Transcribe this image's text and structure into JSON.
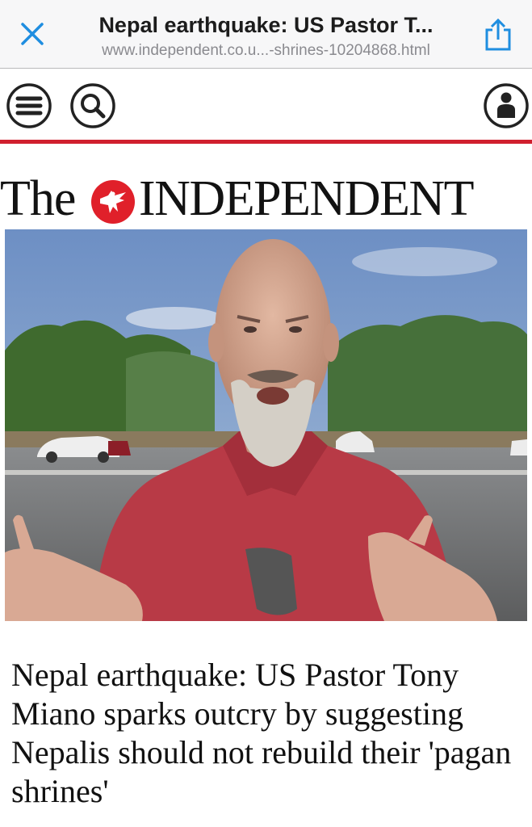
{
  "browser": {
    "page_title": "Nepal earthquake: US Pastor T...",
    "url": "www.independent.co.u...-shrines-10204868.html",
    "close_icon": "close-icon",
    "share_icon": "share-icon"
  },
  "nav": {
    "menu_icon": "menu-icon",
    "search_icon": "search-icon",
    "account_icon": "account-icon"
  },
  "masthead": {
    "the": "The",
    "name": "INDEPENDENT",
    "logo_icon": "eagle-logo"
  },
  "article": {
    "headline": "Nepal earthquake: US Pastor Tony Miano sparks outcry by suggesting Nepalis should not rebuild their 'pagan shrines'"
  },
  "colors": {
    "accent_blue": "#1f8ee0",
    "rule_red": "#d0202e",
    "logo_red": "#e0202a",
    "nav_icon_dark": "#222222"
  }
}
